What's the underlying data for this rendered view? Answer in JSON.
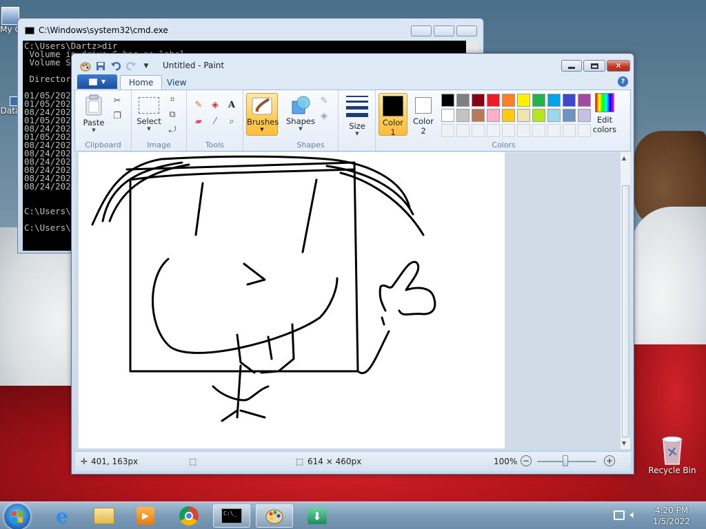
{
  "desktop": {
    "icons": [
      {
        "label": "My C"
      },
      {
        "label": "Data"
      },
      {
        "label": "Recycle Bin"
      }
    ]
  },
  "cmd": {
    "title": "C:\\Windows\\system32\\cmd.exe",
    "lines": [
      "C:\\Users\\Dartz>dir",
      " Volume in drive C has no label.",
      " Volume S",
      "",
      " Director",
      "",
      "01/05/202",
      "01/05/202",
      "08/24/202",
      "01/05/202",
      "08/24/202",
      "01/05/202",
      "08/24/202",
      "08/24/202",
      "08/24/202",
      "08/24/202",
      "08/24/202",
      "08/24/202",
      "",
      "",
      "C:\\Users\\",
      "",
      "C:\\Users\\"
    ]
  },
  "paint": {
    "title": "Untitled - Paint",
    "tabs": [
      "Home",
      "View"
    ],
    "groups": {
      "clipboard": {
        "label": "Clipboard",
        "paste": "Paste"
      },
      "image": {
        "label": "Image",
        "select": "Select"
      },
      "tools": {
        "label": "Tools"
      },
      "brushes": {
        "label": "Brushes"
      },
      "shapes": {
        "label": "Shapes",
        "shapes_btn": "Shapes"
      },
      "size": {
        "label": "Size"
      },
      "colors": {
        "label": "Colors",
        "color1": "Color",
        "color1_num": "1",
        "color2": "Color",
        "color2_num": "2",
        "edit1": "Edit",
        "edit2": "colors",
        "row1": [
          "#000000",
          "#7f7f7f",
          "#880015",
          "#ed1c24",
          "#ff7f27",
          "#fff200",
          "#22b14c",
          "#00a2e8",
          "#3f48cc",
          "#a349a4"
        ],
        "row2": [
          "#ffffff",
          "#c3c3c3",
          "#b97a57",
          "#ffaec9",
          "#ffc90e",
          "#efe4b0",
          "#b5e61d",
          "#99d9ea",
          "#7092be",
          "#c8bfe7"
        ]
      }
    },
    "status": {
      "cursor": "401, 163px",
      "canvas_size": "614 × 460px",
      "zoom": "100%"
    }
  },
  "taskbar": {
    "time": "4:20 PM",
    "date": "1/5/2022"
  }
}
